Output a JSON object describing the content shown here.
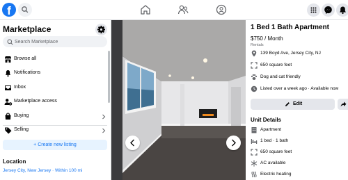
{
  "app": {
    "logo_letter": "f"
  },
  "topbar": {
    "icons": [
      "search-icon",
      "home-icon",
      "friends-icon",
      "groups-icon",
      "menu-grid-icon",
      "messenger-icon",
      "notifications-bell-icon"
    ]
  },
  "sidebar": {
    "title": "Marketplace",
    "search_placeholder": "Search Marketplace",
    "items": [
      {
        "label": "Browse all",
        "icon": "storefront-icon"
      },
      {
        "label": "Notifications",
        "icon": "bell-icon"
      },
      {
        "label": "Inbox",
        "icon": "inbox-icon"
      },
      {
        "label": "Marketplace access",
        "icon": "person-badge-icon"
      },
      {
        "label": "Buying",
        "icon": "shopping-bag-icon"
      },
      {
        "label": "Selling",
        "icon": "tag-icon"
      }
    ],
    "create_label": "+ Create new listing",
    "location_title": "Location",
    "location_value": "Jersey City, New Jersey · Within 100 mi"
  },
  "listing": {
    "title": "1 Bed 1 Bath Apartment",
    "price": "$750 / Month",
    "category": "Rentals",
    "facts": [
      {
        "text": "139 Boyd Ave, Jersey City, NJ",
        "icon": "location-pin-icon"
      },
      {
        "text": "650 square feet",
        "icon": "area-icon"
      },
      {
        "text": "Dog and cat friendly",
        "icon": "paw-icon"
      },
      {
        "text": "Listed over a week ago · Available now",
        "icon": "clock-icon"
      }
    ],
    "edit_label": "Edit",
    "unit_details_title": "Unit Details",
    "unit_details": [
      {
        "text": "Apartment",
        "icon": "building-icon"
      },
      {
        "text": "1 bed · 1 bath",
        "icon": "bed-icon"
      },
      {
        "text": "650 square feet",
        "icon": "area-icon"
      },
      {
        "text": "AC available",
        "icon": "snowflake-icon"
      },
      {
        "text": "Electric heating",
        "icon": "heating-icon"
      }
    ]
  },
  "colors": {
    "brand": "#1877f2",
    "background": "#f0f2f5",
    "button_gray": "#e4e6eb",
    "create_bg": "#e7f3ff"
  }
}
